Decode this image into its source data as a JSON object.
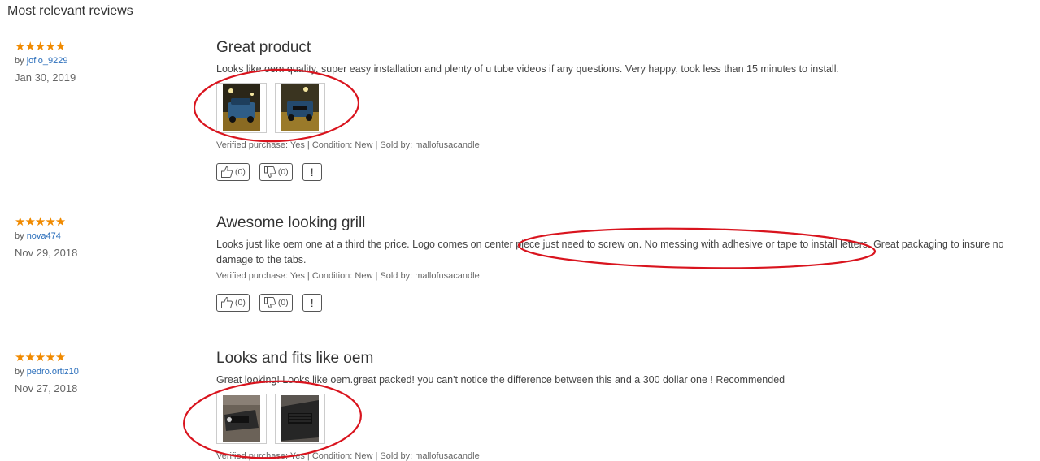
{
  "section_title": "Most relevant reviews",
  "reviews": [
    {
      "stars": "★★★★★",
      "by_label": "by",
      "author": "joflo_9229",
      "date": "Jan 30, 2019",
      "title": "Great product",
      "text": "Looks like oem quality, super easy installation and plenty of u tube videos if any questions.  Very happy, took less than 15 minutes to install.",
      "purchase_info": "Verified purchase: Yes | Condition: New | Sold by: mallofusacandle",
      "helpful_count": "(0)",
      "unhelpful_count": "(0)",
      "report_label": "!"
    },
    {
      "stars": "★★★★★",
      "by_label": "by",
      "author": "nova474",
      "date": "Nov 29, 2018",
      "title": "Awesome looking grill",
      "text": "Looks just like oem one at a third the price. Logo comes on center piece just need to screw on. No messing with adhesive or tape to install letters. Great packaging to insure no damage to the tabs.",
      "purchase_info": "Verified purchase: Yes | Condition: New | Sold by: mallofusacandle",
      "helpful_count": "(0)",
      "unhelpful_count": "(0)",
      "report_label": "!"
    },
    {
      "stars": "★★★★★",
      "by_label": "by",
      "author": "pedro.ortiz10",
      "date": "Nov 27, 2018",
      "title": "Looks and fits like oem",
      "text": "Great looking! Looks like oem.great packed! you can't notice the difference between this and a 300 dollar one ! Recommended",
      "purchase_info": "Verified purchase: Yes | Condition: New | Sold by: mallofusacandle"
    }
  ],
  "colors": {
    "star": "#f08a00",
    "link": "#2a6ebb",
    "annotation": "#d9141e"
  }
}
